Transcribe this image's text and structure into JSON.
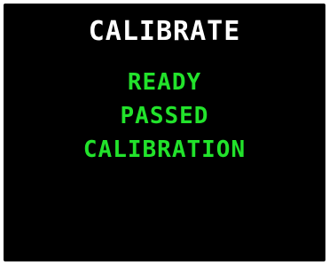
{
  "screen": {
    "title": "CALIBRATE",
    "status_lines": [
      "READY",
      "PASSED",
      "CALIBRATION"
    ],
    "colors": {
      "background": "#000000",
      "title": "#ffffff",
      "status": "#22e32b"
    }
  }
}
